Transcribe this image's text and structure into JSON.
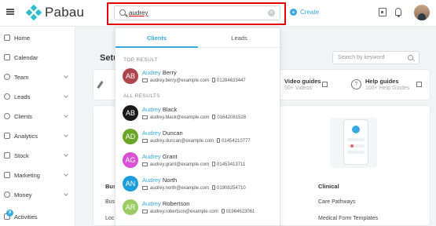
{
  "app": {
    "brand": "Pabau"
  },
  "search": {
    "value": "audrey",
    "clear_icon": "×"
  },
  "create": {
    "label": "Create",
    "plus": "+"
  },
  "sidebar": {
    "items": [
      {
        "label": "Home",
        "icon": "home-icon"
      },
      {
        "label": "Calendar",
        "icon": "calendar-icon"
      },
      {
        "label": "Team",
        "icon": "team-icon"
      },
      {
        "label": "Leads",
        "icon": "leads-icon"
      },
      {
        "label": "Clients",
        "icon": "clients-icon"
      },
      {
        "label": "Analytics",
        "icon": "analytics-icon"
      },
      {
        "label": "Stock",
        "icon": "stock-icon"
      },
      {
        "label": "Marketing",
        "icon": "marketing-icon"
      },
      {
        "label": "Money",
        "icon": "money-icon"
      },
      {
        "label": "Activities",
        "icon": "activities-icon",
        "badge": "9"
      }
    ]
  },
  "page": {
    "title": "Setu",
    "card_search_placeholder": "Search by keyword",
    "video_guides": {
      "title": "Video guides",
      "sub": "50+ Videos"
    },
    "help_guides": {
      "title": "Help guides",
      "sub": "100+ Help Guides"
    },
    "left_col": {
      "heading": "Bus",
      "item1": "Bus",
      "item2": "Loc"
    },
    "clinical": {
      "heading": "Clinical",
      "item1": "Care Pathways",
      "item2": "Medical Form Templates"
    }
  },
  "dropdown": {
    "tabs": {
      "clients": "Clients",
      "leads": "Leads"
    },
    "top_result_label": "TOP RESULT",
    "all_results_label": "ALL RESULTS",
    "top": {
      "initials": "AB",
      "first": "Audrey",
      "last": "Berry",
      "email": "audrey.berry@example.com",
      "phone": "01284633447",
      "color": "#b0444d"
    },
    "results": [
      {
        "initials": "AB",
        "first": "Audrey",
        "last": "Black",
        "email": "audrey.black@example.com",
        "phone": "01642081528",
        "color": "#1a1a1a"
      },
      {
        "initials": "AD",
        "first": "Audrey",
        "last": "Duncan",
        "email": "audrey.duncan@example.com",
        "phone": "01454210777",
        "color": "#6aa625"
      },
      {
        "initials": "AG",
        "first": "Audrey",
        "last": "Grant",
        "email": "audrey.grant@example.com",
        "phone": "01453413711",
        "color": "#d94fd6"
      },
      {
        "initials": "AN",
        "first": "Audrey",
        "last": "North",
        "email": "audrey.north@example.com",
        "phone": "01908254710",
        "color": "#1d9dd9"
      },
      {
        "initials": "AR",
        "first": "Audrey",
        "last": "Robertson",
        "email": "audrey.robertson@example.com",
        "phone": "01964623061",
        "color": "#9ccc65"
      }
    ]
  }
}
